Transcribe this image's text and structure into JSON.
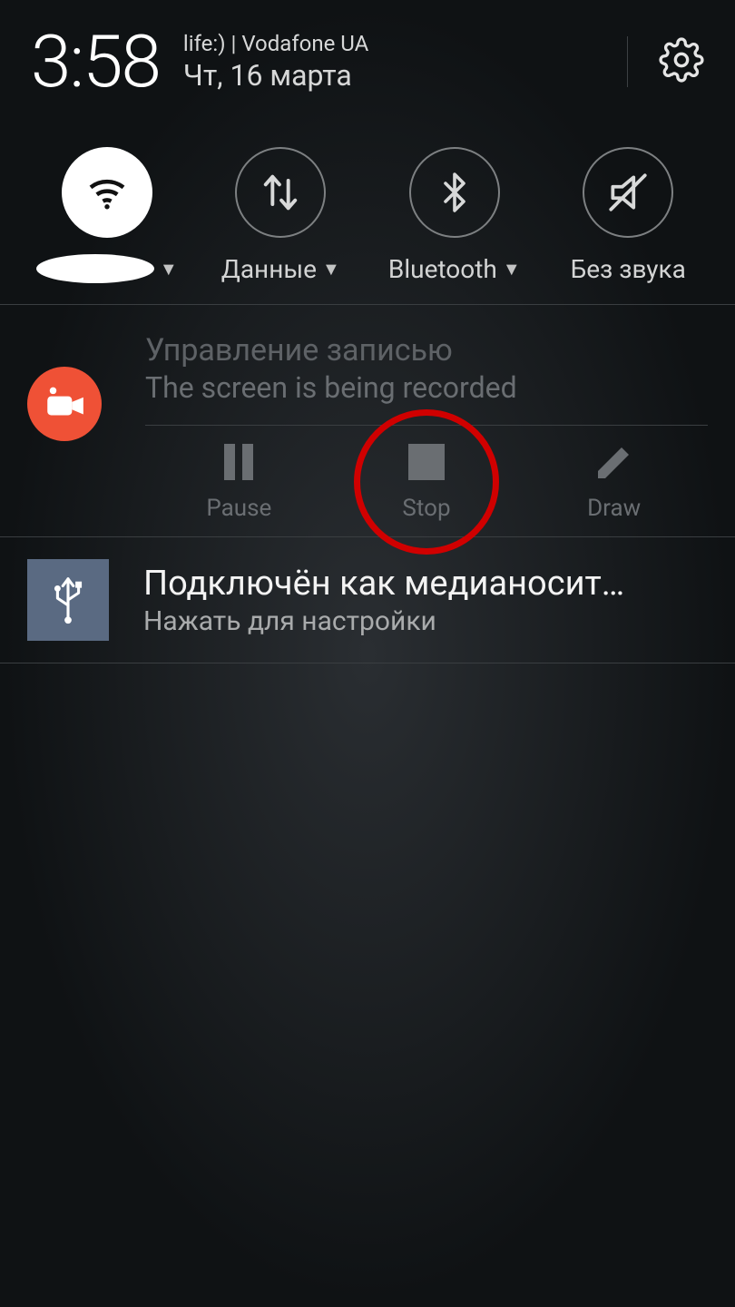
{
  "header": {
    "time": "3:58",
    "carrier": "life:) | Vodafone UA",
    "date": "Чт, 16 марта"
  },
  "qs": {
    "wifi": {
      "active": true
    },
    "data": {
      "label": "Данные"
    },
    "bluetooth": {
      "label": "Bluetooth"
    },
    "mute": {
      "label": "Без звука"
    }
  },
  "recorder": {
    "title": "Управление записью",
    "subtitle": "The screen is being recorded",
    "actions": {
      "pause": "Pause",
      "stop": "Stop",
      "draw": "Draw"
    }
  },
  "usb": {
    "title": "Подключён как медианосит…",
    "subtitle": "Нажать для настройки"
  }
}
